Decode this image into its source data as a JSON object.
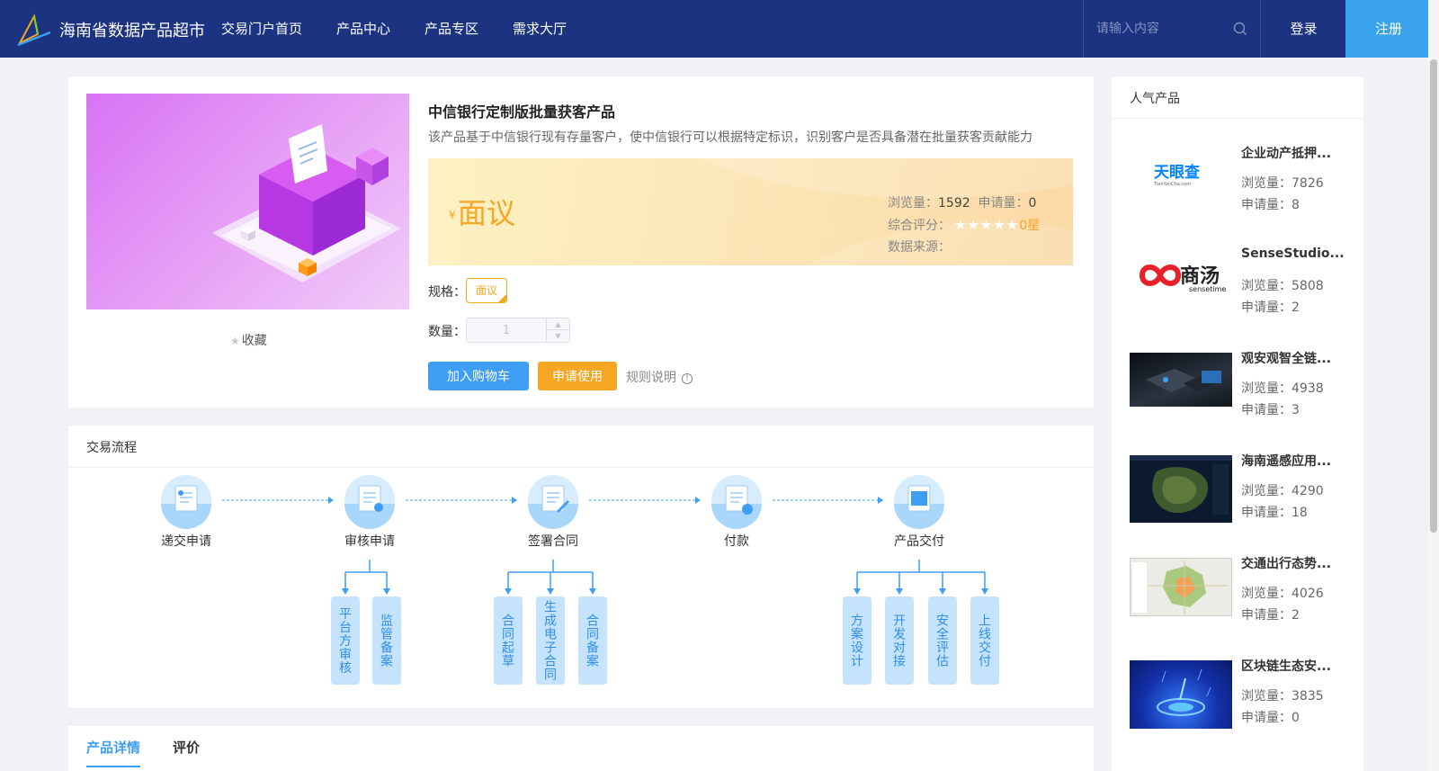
{
  "header": {
    "brand": "海南省数据产品超市",
    "nav": [
      "交易门户首页",
      "产品中心",
      "产品专区",
      "需求大厅"
    ],
    "search_placeholder": "请输入内容",
    "login": "登录",
    "register": "注册"
  },
  "product": {
    "title": "中信银行定制版批量获客产品",
    "description": "该产品基于中信银行现有存量客户，使中信银行可以根据特定标识，识别客户是否具备潜在批量获客贡献能力",
    "currency": "¥",
    "price": "面议",
    "views_label": "浏览量：",
    "views": "1592",
    "requests_label": "申请量：",
    "requests": "0",
    "rating_label": "综合评分：",
    "rating": "0星",
    "rating_stars": 0,
    "source_label": "数据来源：",
    "spec_label": "规格：",
    "spec_value": "面议",
    "qty_label": "数量：",
    "qty_value": "1",
    "favorite": "收藏",
    "add_cart": "加入购物车",
    "apply": "申请使用",
    "rules": "规则说明"
  },
  "flow": {
    "title": "交易流程",
    "steps": [
      "递交申请",
      "审核申请",
      "签署合同",
      "付款",
      "产品交付"
    ],
    "sub_steps": {
      "review": [
        "平台方审核",
        "监管备案"
      ],
      "contract": [
        "合同起草",
        "生成电子合同",
        "合同备案"
      ],
      "delivery": [
        "方案设计",
        "开发对接",
        "安全评估",
        "上线交付"
      ]
    }
  },
  "tabs": [
    "产品详情",
    "评价"
  ],
  "popular": {
    "title": "人气产品",
    "views_label": "浏览量：",
    "requests_label": "申请量：",
    "items": [
      {
        "name": "企业动产抵押...",
        "views": "7826",
        "requests": "8",
        "logo_text": "天眼查",
        "logo_sub": "TianYanCha.com"
      },
      {
        "name": "SenseStudio...",
        "views": "5808",
        "requests": "2",
        "logo_text": "商汤",
        "logo_sub": "sensetime"
      },
      {
        "name": "观安观智全链...",
        "views": "4938",
        "requests": "3"
      },
      {
        "name": "海南遥感应用...",
        "views": "4290",
        "requests": "18"
      },
      {
        "name": "交通出行态势...",
        "views": "4026",
        "requests": "2"
      },
      {
        "name": "区块链生态安...",
        "views": "3835",
        "requests": "0"
      }
    ]
  },
  "colors": {
    "header_bg": "#1b3381",
    "primary": "#3e9ef4",
    "accent": "#f5a623",
    "register_bg": "#3aa3f0"
  }
}
